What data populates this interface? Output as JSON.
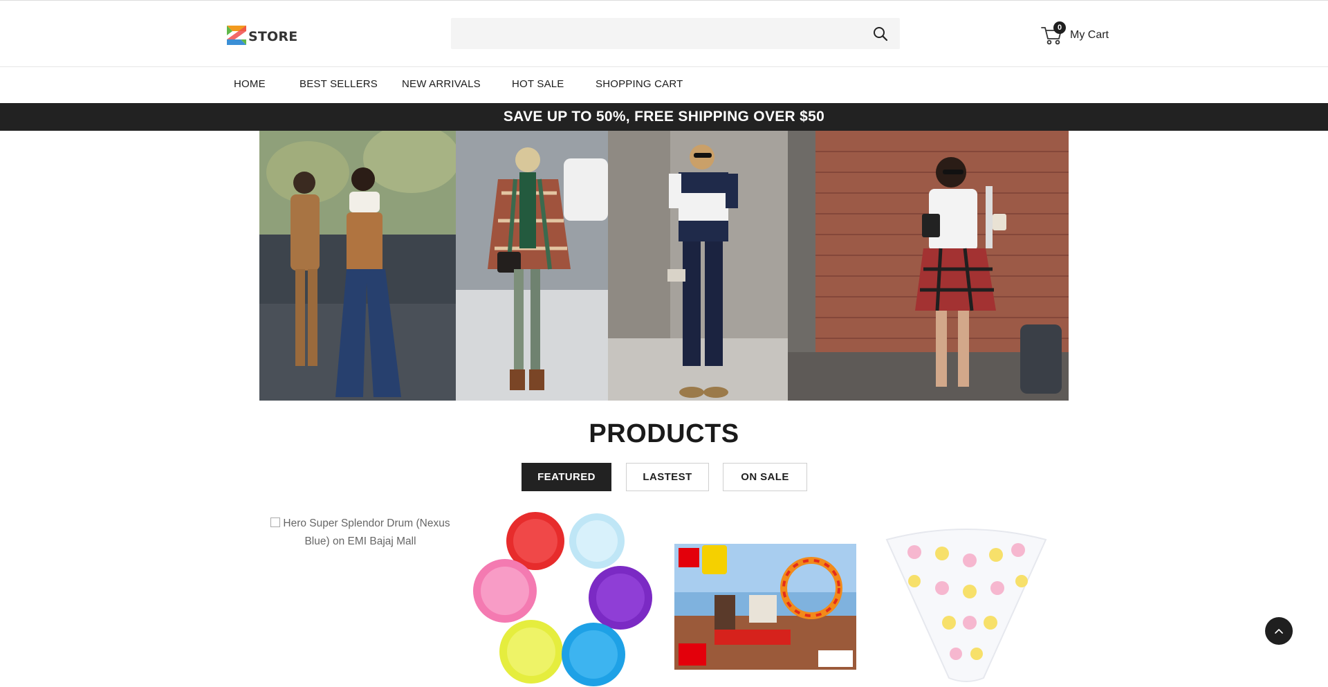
{
  "header": {
    "logo_text": "STORE",
    "search": {
      "placeholder": "",
      "value": ""
    },
    "cart": {
      "count": "0",
      "label": "My Cart"
    }
  },
  "nav": {
    "items": [
      {
        "label": "HOME"
      },
      {
        "label": "BEST SELLERS"
      },
      {
        "label": "NEW ARRIVALS"
      },
      {
        "label": "HOT SALE"
      },
      {
        "label": "SHOPPING CART"
      }
    ]
  },
  "promo": {
    "text": "SAVE UP TO 50%, FREE SHIPPING OVER $50"
  },
  "products": {
    "title": "PRODUCTS",
    "tabs": [
      {
        "label": "FEATURED",
        "active": true
      },
      {
        "label": "LASTEST",
        "active": false
      },
      {
        "label": "ON SALE",
        "active": false
      }
    ],
    "items": [
      {
        "image_alt": "Hero Super Splendor Drum (Nexus Blue) on EMI Bajaj Mall",
        "image_broken": true
      },
      {
        "image": "silicone cupcake liners"
      },
      {
        "image": "LEGO Toy Story 4 set box"
      },
      {
        "image": "baby bandana bib"
      }
    ]
  },
  "colors": {
    "promo_bar": "#222222",
    "tab_active": "#222222",
    "search_bg": "#f4f4f4",
    "logo_orange": "#f29a1e",
    "logo_green": "#5fb84a",
    "logo_blue": "#3b8fd6"
  },
  "icons": {
    "search": "search-icon",
    "cart": "cart-icon",
    "scroll_top": "chevron-up-icon"
  }
}
